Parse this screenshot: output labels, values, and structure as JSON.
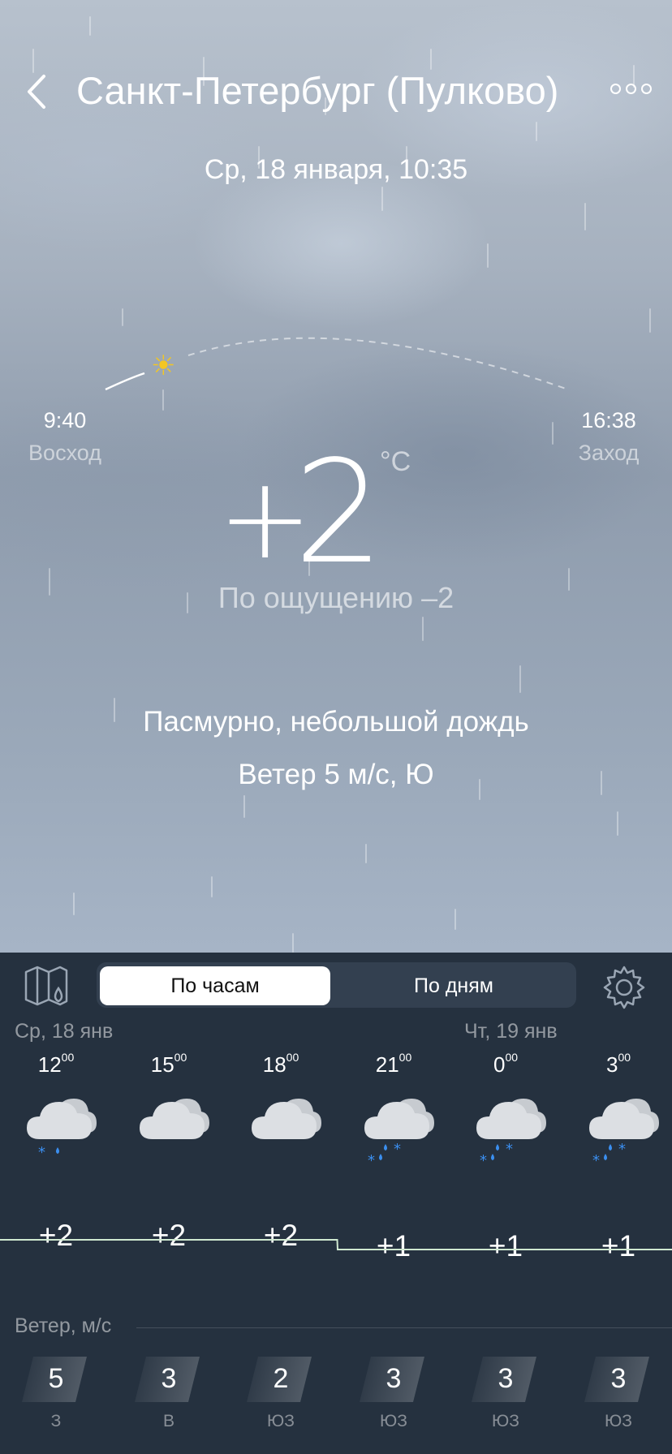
{
  "header": {
    "title": "Санкт-Петербург (Пулково)",
    "date": "Ср, 18 января, 10:35"
  },
  "sun": {
    "sunrise_time": "9:40",
    "sunrise_label": "Восход",
    "sunset_time": "16:38",
    "sunset_label": "Заход"
  },
  "current": {
    "temp_sign": "+",
    "temp_value": "2",
    "unit": "°C",
    "feels_like": "По ощущению –2",
    "condition": "Пасмурно, небольшой дождь",
    "wind": "Ветер 5 м/с, Ю"
  },
  "tabs": {
    "hourly": "По часам",
    "daily": "По дням"
  },
  "days": {
    "day1": "Ср, 18 янв",
    "day2": "Чт, 19 янв"
  },
  "hourly": [
    {
      "hour": "12",
      "min": "00",
      "icon": "cloud-rain-snow-icon",
      "temp": "+2",
      "wind": "5",
      "dir": "З"
    },
    {
      "hour": "15",
      "min": "00",
      "icon": "cloud-icon",
      "temp": "+2",
      "wind": "3",
      "dir": "В"
    },
    {
      "hour": "18",
      "min": "00",
      "icon": "cloud-icon",
      "temp": "+2",
      "wind": "2",
      "dir": "ЮЗ"
    },
    {
      "hour": "21",
      "min": "00",
      "icon": "cloud-sleet-icon",
      "temp": "+1",
      "wind": "3",
      "dir": "ЮЗ"
    },
    {
      "hour": "0",
      "min": "00",
      "icon": "cloud-sleet-icon",
      "temp": "+1",
      "wind": "3",
      "dir": "ЮЗ"
    },
    {
      "hour": "3",
      "min": "00",
      "icon": "cloud-sleet-icon",
      "temp": "+1",
      "wind": "3",
      "dir": "ЮЗ"
    }
  ],
  "wind_title": "Ветер, м/с",
  "colors": {
    "panel_bg": "#25313f",
    "accent_blue": "#3b8ff0",
    "sun": "#f3c623",
    "temp_line": "#cfe8d0"
  }
}
